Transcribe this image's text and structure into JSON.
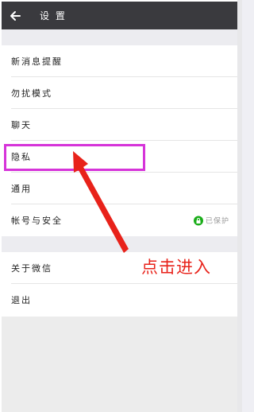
{
  "header": {
    "title": "设 置",
    "back_icon": "arrow-left-icon"
  },
  "sections": [
    {
      "items": [
        {
          "label": "新消息提醒"
        },
        {
          "label": "勿扰模式"
        },
        {
          "label": "聊天"
        },
        {
          "label": "隐私"
        },
        {
          "label": "通用"
        },
        {
          "label": "帐号与安全",
          "status": "已保护",
          "status_icon": "lock-icon",
          "status_color": "#1aad19"
        }
      ]
    },
    {
      "items": [
        {
          "label": "关于微信"
        },
        {
          "label": "退出"
        }
      ]
    }
  ],
  "annotation": {
    "text": "点击进入",
    "highlight_color": "#d634d9",
    "arrow_color": "#e8221a"
  }
}
